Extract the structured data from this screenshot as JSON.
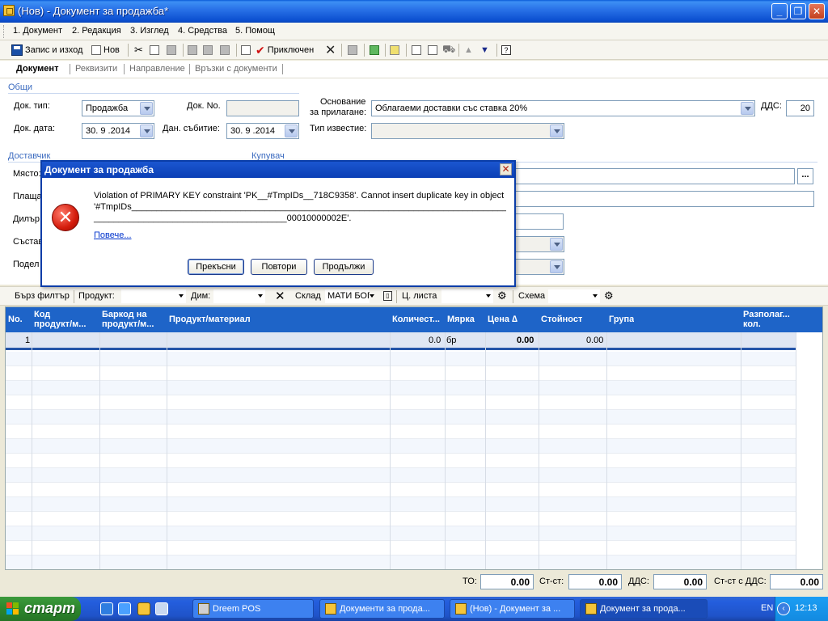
{
  "window": {
    "title": "(Нов) - Документ за продажба*"
  },
  "menu": [
    "1. Документ",
    "2. Редакция",
    "3. Изглед",
    "4. Средства",
    "5. Помощ"
  ],
  "toolbar": {
    "save_exit": "Запис и изход",
    "new": "Нов",
    "finished": "Приключен"
  },
  "tabs": [
    "Документ",
    "Реквизити",
    "Направление",
    "Връзки с документи"
  ],
  "form": {
    "section_general": "Общи",
    "doc_type_label": "Док. тип:",
    "doc_type_value": "Продажба",
    "doc_no_label": "Док. No.",
    "doc_no_value": "",
    "basis_label_1": "Основание",
    "basis_label_2": "за прилагане:",
    "basis_value": "Облагаеми доставки със ставка 20%",
    "vat_label": "ДДС:",
    "vat_value": "20",
    "doc_date_label": "Док. дата:",
    "doc_date_value": "30. 9 .2014",
    "tax_event_label": "Дан. събитие:",
    "tax_event_value": "30. 9 .2014",
    "notice_type_label": "Тип известие:",
    "notice_type_value": "",
    "section_supplier": "Доставчик",
    "section_buyer": "Купувач",
    "place_label": "Място:",
    "payment_label": "Плаща",
    "dealer_label": "Дилър",
    "compiled_label": "Състав",
    "division_label": "Подел",
    "browse": "..."
  },
  "filterbar": {
    "quick_filter": "Бърз филтър",
    "product_label": "Продукт:",
    "dim_label": "Дим:",
    "warehouse_label": "Склад",
    "warehouse_value": "МАТИ БОГ",
    "pricelist_label": "Ц. листа",
    "scheme_label": "Схема"
  },
  "grid": {
    "headers": {
      "no": "No.",
      "code_1": "Код",
      "code_2": "продукт/м...",
      "barcode_1": "Баркод на",
      "barcode_2": "продукт/м...",
      "product": "Продукт/материал",
      "qty": "Количест...",
      "unit": "Мярка",
      "price": "Цена ∆",
      "value": "Стойност",
      "group": "Група",
      "avail_1": "Разполаг...",
      "avail_2": "кол."
    },
    "rows": [
      {
        "no": "1",
        "qty": "0.0",
        "unit": "бр",
        "price": "0.00",
        "value": "0.00"
      }
    ]
  },
  "totals": {
    "to_label": "ТО:",
    "to_value": "0.00",
    "cost_label": "Ст-ст:",
    "cost_value": "0.00",
    "vat_label": "ДДС:",
    "vat_value": "0.00",
    "cost_vat_label": "Ст-ст с ДДС:",
    "cost_vat_value": "0.00"
  },
  "dialog": {
    "title": "Документ за продажба",
    "message_1": "Violation of PRIMARY KEY constraint 'PK__#TmpIDs__718C9358'. Cannot insert duplicate key in object",
    "message_2": "'#TmpIDs_____________________________________________________________________________________________",
    "message_3": "_______________________________________00010000002E'.",
    "more": "Повече...",
    "btn_abort": "Прекъсни",
    "btn_retry": "Повтори",
    "btn_continue": "Продължи"
  },
  "taskbar": {
    "start": "старт",
    "tasks": [
      "Dreem POS",
      "Документи за прода...",
      "(Нов) - Документ за ...",
      "Документ за прода..."
    ],
    "lang": "EN",
    "clock": "12:13"
  }
}
